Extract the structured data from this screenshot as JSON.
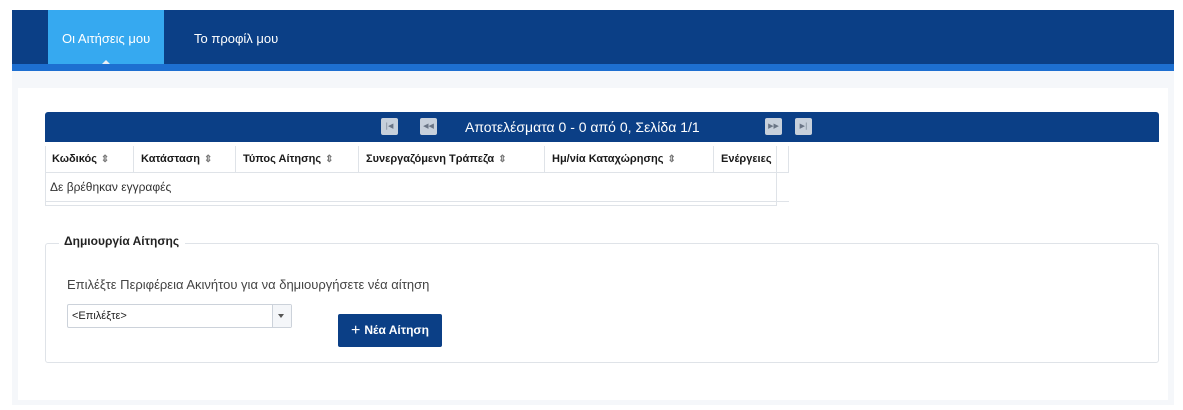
{
  "nav": {
    "tabs": [
      {
        "label": "Οι Αιτήσεις μου",
        "active": true
      },
      {
        "label": "Το προφίλ μου",
        "active": false
      }
    ]
  },
  "colors": {
    "header": "#0b3f86",
    "header_underline": "#1d6fd1",
    "active_tab": "#36a9f0",
    "primary_button": "#0b3f86"
  },
  "pager": {
    "text": "Αποτελέσματα 0 - 0 από 0, Σελίδα 1/1",
    "first_icon": "first-page-icon",
    "prev_icon": "prev-page-icon",
    "next_icon": "next-page-icon",
    "last_icon": "last-page-icon"
  },
  "table": {
    "columns": [
      {
        "label": "Κωδικός",
        "sortable": true
      },
      {
        "label": "Κατάσταση",
        "sortable": true
      },
      {
        "label": "Τύπος Αίτησης",
        "sortable": true
      },
      {
        "label": "Συνεργαζόμενη Τράπεζα",
        "sortable": true
      },
      {
        "label": "Ημ/νία Καταχώρησης",
        "sortable": true
      },
      {
        "label": "Ενέργειες",
        "sortable": false
      }
    ],
    "empty_message": "Δε βρέθηκαν εγγραφές"
  },
  "create": {
    "legend": "Δημιουργία Αίτησης",
    "instruction": "Επιλέξτε Περιφέρεια Ακινήτου για να δημιουργήσετε νέα αίτηση",
    "select_value": "<Επιλέξτε>",
    "button_label": "Νέα Αίτηση",
    "button_icon": "plus-icon"
  }
}
